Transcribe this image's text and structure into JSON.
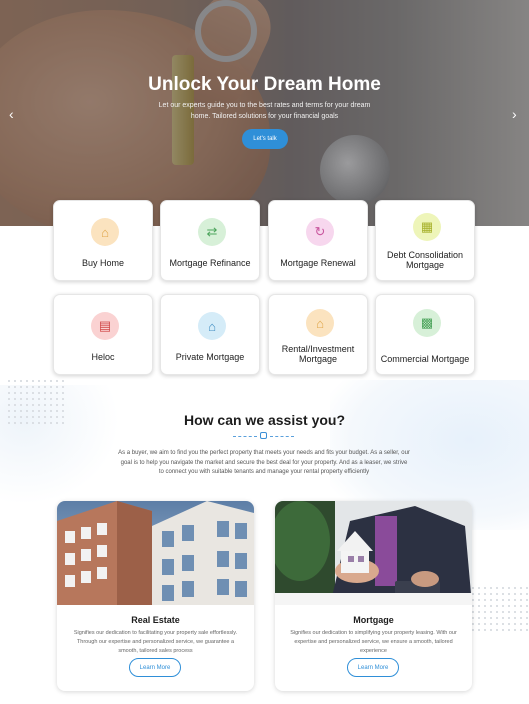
{
  "hero": {
    "title": "Unlock Your Dream Home",
    "subtitle": "Let our experts guide you to the best rates and terms for your dream home. Tailored solutions for your financial goals",
    "cta": "Let's talk",
    "prev_icon": "chevron-left-icon",
    "next_icon": "chevron-right-icon"
  },
  "services": [
    {
      "label": "Buy Home",
      "icon": "house-icon",
      "color": "#fbe3bf"
    },
    {
      "label": "Mortgage Refinance",
      "icon": "refinance-icon",
      "color": "#d7f0d8"
    },
    {
      "label": "Mortgage Renewal",
      "icon": "renewal-icon",
      "color": "#f7d7ee"
    },
    {
      "label": "Debt Consolidation Mortgage",
      "icon": "debt-icon",
      "color": "#eef5b9"
    },
    {
      "label": "Heloc",
      "icon": "document-icon",
      "color": "#fad2d2"
    },
    {
      "label": "Private Mortgage",
      "icon": "private-house-icon",
      "color": "#d5ecf8"
    },
    {
      "label": "Rental/Investment Mortgage",
      "icon": "rental-icon",
      "color": "#fbe3bf"
    },
    {
      "label": "Commercial Mortgage",
      "icon": "commercial-icon",
      "color": "#d7f0d8"
    }
  ],
  "assist": {
    "title": "How can we assist you?",
    "text": "As a buyer, we aim to find you the perfect property that meets your needs and fits your budget. As a seller, our goal is to help you navigate the market and secure the best deal for your property. And as a leaser, we strive to connect you with suitable tenants and manage your rental property efficiently"
  },
  "features": [
    {
      "title": "Real Estate",
      "text": "Signifies our dedication to facilitating your property sale effortlessly. Through our expertise and personalized service, we guarantee a smooth, tailored sales process",
      "button": "Learn More"
    },
    {
      "title": "Mortgage",
      "text": "Signifies our dedication to simplifying your property leasing. With our expertise and personalized service, we ensure a smooth, tailored experience",
      "button": "Learn More"
    }
  ],
  "colors": {
    "accent": "#2f8fd8"
  }
}
